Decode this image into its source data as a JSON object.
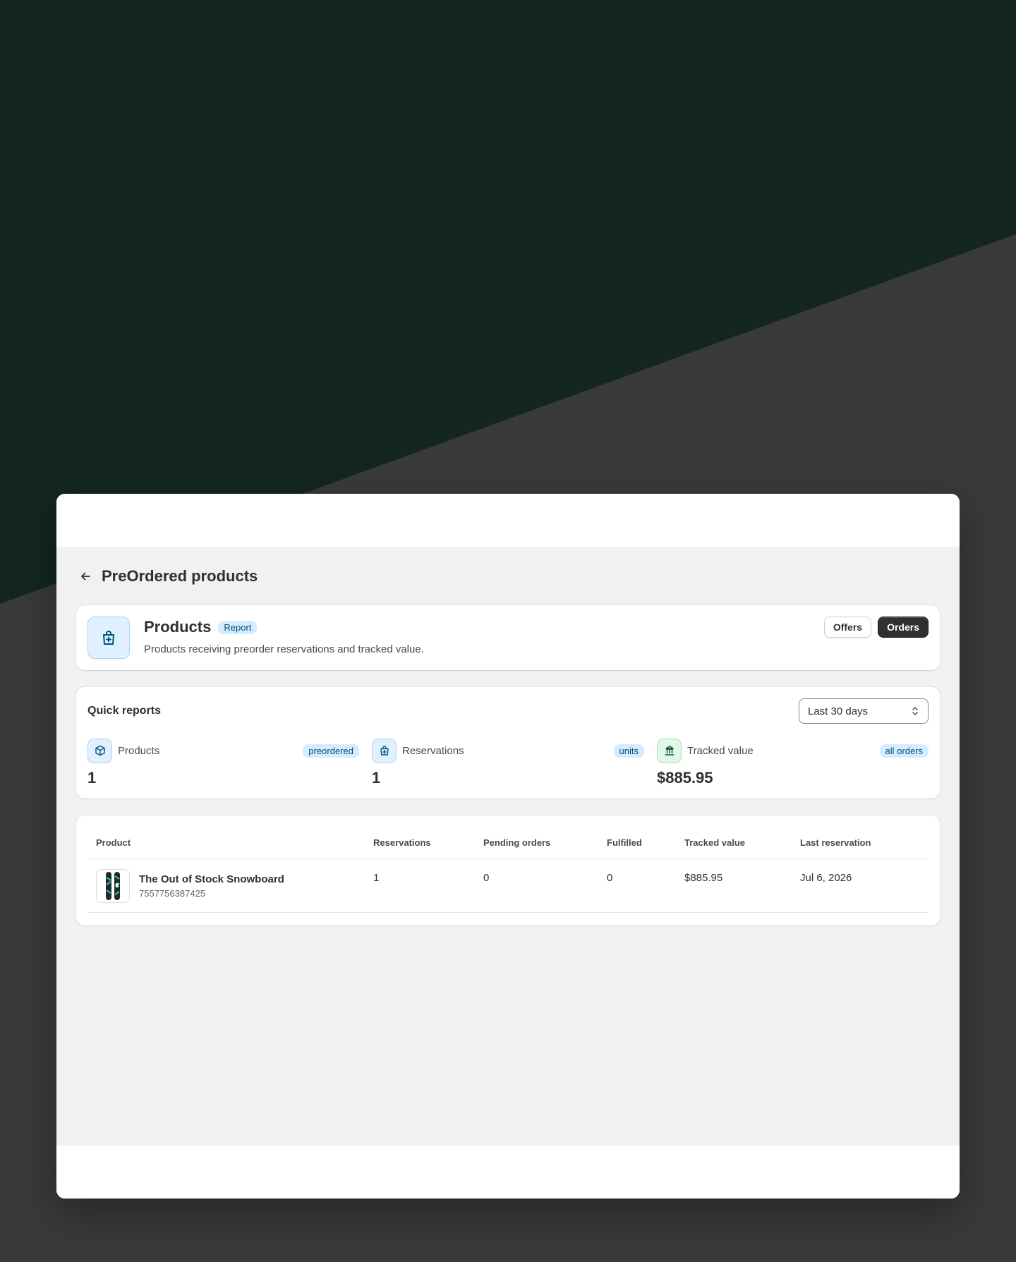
{
  "colors": {
    "background_top": "#13271f",
    "background_bottom": "#3a3a3a",
    "badge_bg": "#d5ebff",
    "badge_text": "#00527c",
    "primary_button": "#303030"
  },
  "page": {
    "back_icon": "arrow-left-icon",
    "title": "PreOrdered products"
  },
  "header_card": {
    "icon": "shopping-bag-plus-icon",
    "title": "Products",
    "badge": "Report",
    "description": "Products receiving preorder reservations and tracked value.",
    "buttons": {
      "offers": "Offers",
      "orders": "Orders"
    }
  },
  "quick_reports": {
    "title": "Quick reports",
    "date_range": "Last 30 days",
    "metrics": [
      {
        "icon": "package-icon",
        "label": "Products",
        "badge": "preordered",
        "value": "1"
      },
      {
        "icon": "bag-icon",
        "label": "Reservations",
        "badge": "units",
        "value": "1"
      },
      {
        "icon": "bank-icon",
        "label": "Tracked value",
        "badge": "all orders",
        "value": "$885.95"
      }
    ]
  },
  "table": {
    "columns": [
      "Product",
      "Reservations",
      "Pending orders",
      "Fulfilled",
      "Tracked value",
      "Last reservation"
    ],
    "rows": [
      {
        "product_name": "The Out of Stock Snowboard",
        "product_id": "7557756387425",
        "reservations": "1",
        "pending_orders": "0",
        "fulfilled": "0",
        "tracked_value": "$885.95",
        "last_reservation": "Jul 6, 2026"
      }
    ]
  }
}
